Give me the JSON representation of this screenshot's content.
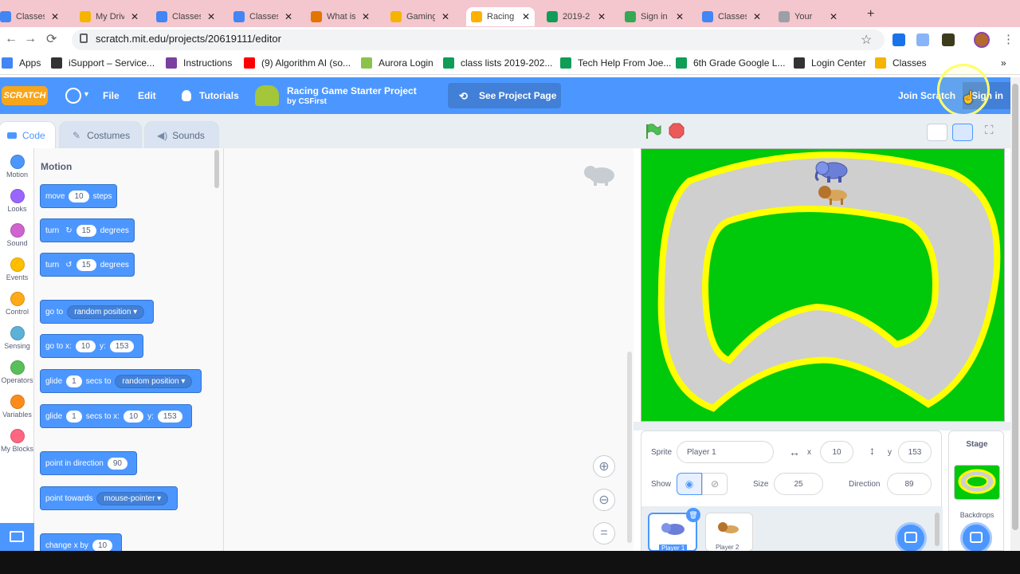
{
  "browser": {
    "tabs": [
      {
        "title": "Classes",
        "color": "#4285f4"
      },
      {
        "title": "My Drive",
        "color": "#f4b400"
      },
      {
        "title": "Classes",
        "color": "#4285f4"
      },
      {
        "title": "Classes",
        "color": "#4285f4"
      },
      {
        "title": "What is",
        "color": "#e37400"
      },
      {
        "title": "Gaming",
        "color": "#f4b400"
      },
      {
        "title": "Racing",
        "color": "#ffb000"
      },
      {
        "title": "2019-2",
        "color": "#0f9d58"
      },
      {
        "title": "Sign in",
        "color": "#34a853"
      },
      {
        "title": "Classes",
        "color": "#4285f4"
      },
      {
        "title": "Your",
        "color": "#9aa0a6"
      }
    ],
    "url": "scratch.mit.edu/projects/20619111/editor",
    "bookmarks": [
      {
        "label": "Apps",
        "icon": "apps-grid-icon"
      },
      {
        "label": "iSupport – Service...",
        "icon": "isupport-icon"
      },
      {
        "label": "Instructions",
        "icon": "instructions-icon"
      },
      {
        "label": "(9) Algorithm AI (so...",
        "icon": "youtube-icon"
      },
      {
        "label": "Aurora Login",
        "icon": "aurora-icon"
      },
      {
        "label": "class lists 2019-202...",
        "icon": "drive-icon"
      },
      {
        "label": "Tech Help From Joe...",
        "icon": "drive-icon"
      },
      {
        "label": "6th Grade Google L...",
        "icon": "drive-icon"
      },
      {
        "label": "Login Center",
        "icon": "globe-icon"
      },
      {
        "label": "Classes",
        "icon": "classroom-icon"
      }
    ],
    "more": "»"
  },
  "menubar": {
    "logo": "SCRATCH",
    "file": "File",
    "edit": "Edit",
    "tutorials": "Tutorials",
    "project_title": "Racing Game Starter Project",
    "project_author": "by CSFirst",
    "see_project": "See Project Page",
    "join": "Join Scratch",
    "signin": "Sign in"
  },
  "tabs": {
    "code": "Code",
    "costumes": "Costumes",
    "sounds": "Sounds"
  },
  "categories": [
    {
      "label": "Motion",
      "color": "#4c97ff"
    },
    {
      "label": "Looks",
      "color": "#9966ff"
    },
    {
      "label": "Sound",
      "color": "#cf63cf"
    },
    {
      "label": "Events",
      "color": "#ffbf00"
    },
    {
      "label": "Control",
      "color": "#ffab19"
    },
    {
      "label": "Sensing",
      "color": "#5cb1d6"
    },
    {
      "label": "Operators",
      "color": "#59c059"
    },
    {
      "label": "Variables",
      "color": "#ff8c1a"
    },
    {
      "label": "My Blocks",
      "color": "#ff6680"
    }
  ],
  "palette": {
    "heading": "Motion",
    "move": {
      "a": "move",
      "v": "10",
      "b": "steps"
    },
    "turn_right": {
      "a": "turn",
      "v": "15",
      "b": "degrees"
    },
    "turn_left": {
      "a": "turn",
      "v": "15",
      "b": "degrees"
    },
    "goto": {
      "a": "go to",
      "dd": "random position"
    },
    "gotoxy": {
      "a": "go to x:",
      "x": "10",
      "yl": "y:",
      "y": "153"
    },
    "glide_to": {
      "a": "glide",
      "v": "1",
      "b": "secs to",
      "dd": "random position"
    },
    "glide_xy": {
      "a": "glide",
      "v": "1",
      "b": "secs to x:",
      "x": "10",
      "yl": "y:",
      "y": "153"
    },
    "point_dir": {
      "a": "point in direction",
      "v": "90"
    },
    "point_towards": {
      "a": "point towards",
      "dd": "mouse-pointer"
    },
    "change_x": {
      "a": "change x by",
      "v": "10"
    }
  },
  "sprite_info": {
    "sprite_label": "Sprite",
    "sprite_name": "Player 1",
    "x_label": "x",
    "x": "10",
    "y_label": "y",
    "y": "153",
    "show_label": "Show",
    "size_label": "Size",
    "size": "25",
    "direction_label": "Direction",
    "direction": "89",
    "sprites": [
      "Player 1",
      "Player 2"
    ]
  },
  "stage_pane": {
    "title": "Stage",
    "backdrops": "Backdrops"
  },
  "colors": {
    "scratch_blue": "#4c97ff",
    "track_yellow": "#ffff00",
    "grass": "#00c80a",
    "track_gray": "#cfcfcf"
  }
}
